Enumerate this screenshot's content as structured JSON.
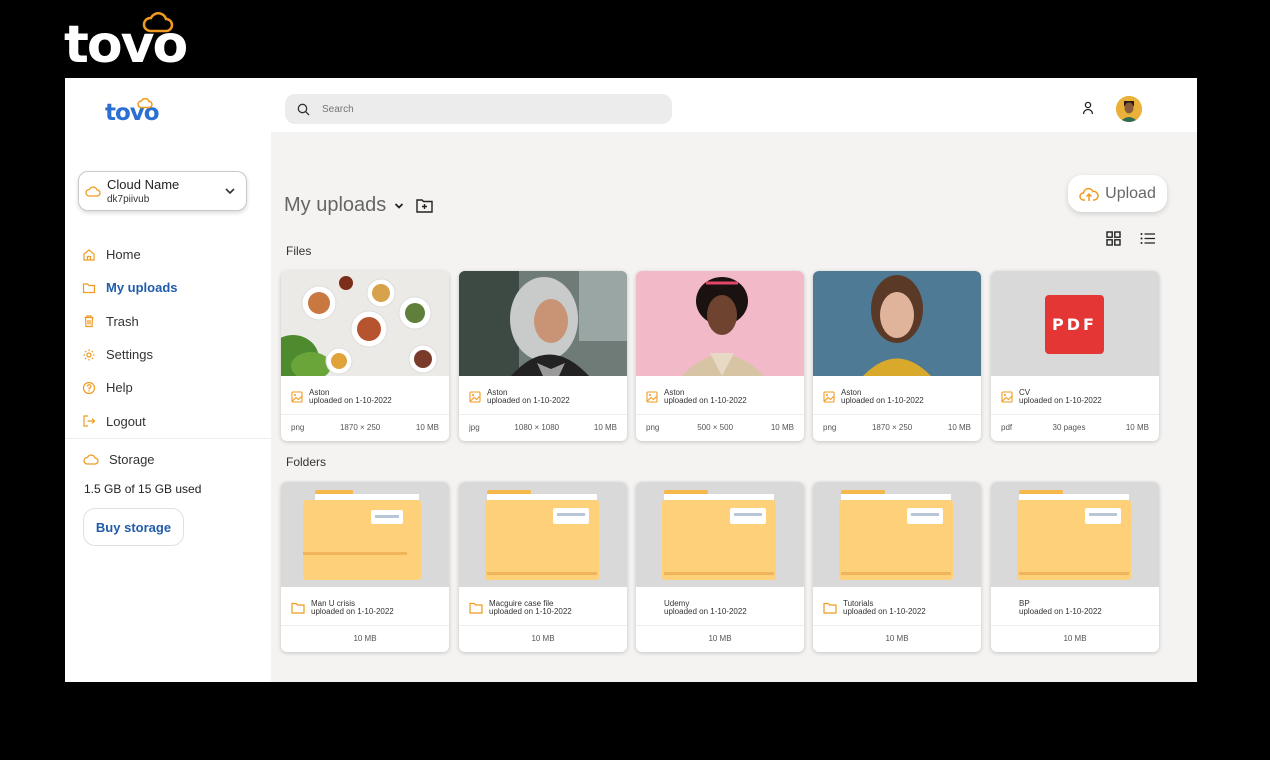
{
  "brand": {
    "name": "tovo"
  },
  "sidebar": {
    "logo": "tovo",
    "cloud": {
      "name": "Cloud Name",
      "id": "dk7piivub"
    },
    "nav": [
      {
        "label": "Home",
        "icon": "home-icon",
        "active": false
      },
      {
        "label": "My uploads",
        "icon": "folder-icon",
        "active": true
      },
      {
        "label": "Trash",
        "icon": "trash-icon",
        "active": false
      },
      {
        "label": "Settings",
        "icon": "gear-icon",
        "active": false
      },
      {
        "label": "Help",
        "icon": "help-icon",
        "active": false
      },
      {
        "label": "Logout",
        "icon": "logout-icon",
        "active": false
      }
    ],
    "storage": {
      "label": "Storage",
      "used": "1.5 GB of 15 GB used",
      "buy_label": "Buy storage"
    }
  },
  "topbar": {
    "search_placeholder": "Search"
  },
  "main": {
    "title": "My uploads",
    "upload_label": "Upload",
    "files_label": "Files",
    "folders_label": "Folders",
    "files": [
      {
        "name": "Aston",
        "uploaded": "uploaded on 1-10-2022",
        "type": "png",
        "dims": "1870 × 250",
        "size": "10 MB",
        "thumb": "food"
      },
      {
        "name": "Aston",
        "uploaded": "uploaded on 1-10-2022",
        "type": "jpg",
        "dims": "1080 × 1080",
        "size": "10 MB",
        "thumb": "woman-gray"
      },
      {
        "name": "Aston",
        "uploaded": "uploaded on 1-10-2022",
        "type": "png",
        "dims": "500 × 500",
        "size": "10 MB",
        "thumb": "woman-pink"
      },
      {
        "name": "Aston",
        "uploaded": "uploaded on 1-10-2022",
        "type": "png",
        "dims": "1870 × 250",
        "size": "10 MB",
        "thumb": "woman-blue"
      },
      {
        "name": "CV",
        "uploaded": "uploaded on 1-10-2022",
        "type": "pdf",
        "dims": "30 pages",
        "size": "10 MB",
        "thumb": "pdf",
        "pdf_text": "PDF"
      }
    ],
    "folders": [
      {
        "name": "Man U crisis",
        "uploaded": "uploaded on 1-10-2022",
        "size": "10 MB",
        "icon": true
      },
      {
        "name": "Macguire case file",
        "uploaded": "uploaded on 1-10-2022",
        "size": "10 MB",
        "icon": true
      },
      {
        "name": "Udemy",
        "uploaded": "uploaded on 1-10-2022",
        "size": "10 MB",
        "icon": false
      },
      {
        "name": "Tutorials",
        "uploaded": "uploaded on 1-10-2022",
        "size": "10 MB",
        "icon": true
      },
      {
        "name": "BP",
        "uploaded": "uploaded on 1-10-2022",
        "size": "10 MB",
        "icon": false
      }
    ]
  },
  "colors": {
    "accent": "#1f5cab",
    "orange": "#f19a1f",
    "folder": "#ffd07a",
    "content_bg": "#f4f3f1",
    "pdf_red": "#e53636"
  }
}
